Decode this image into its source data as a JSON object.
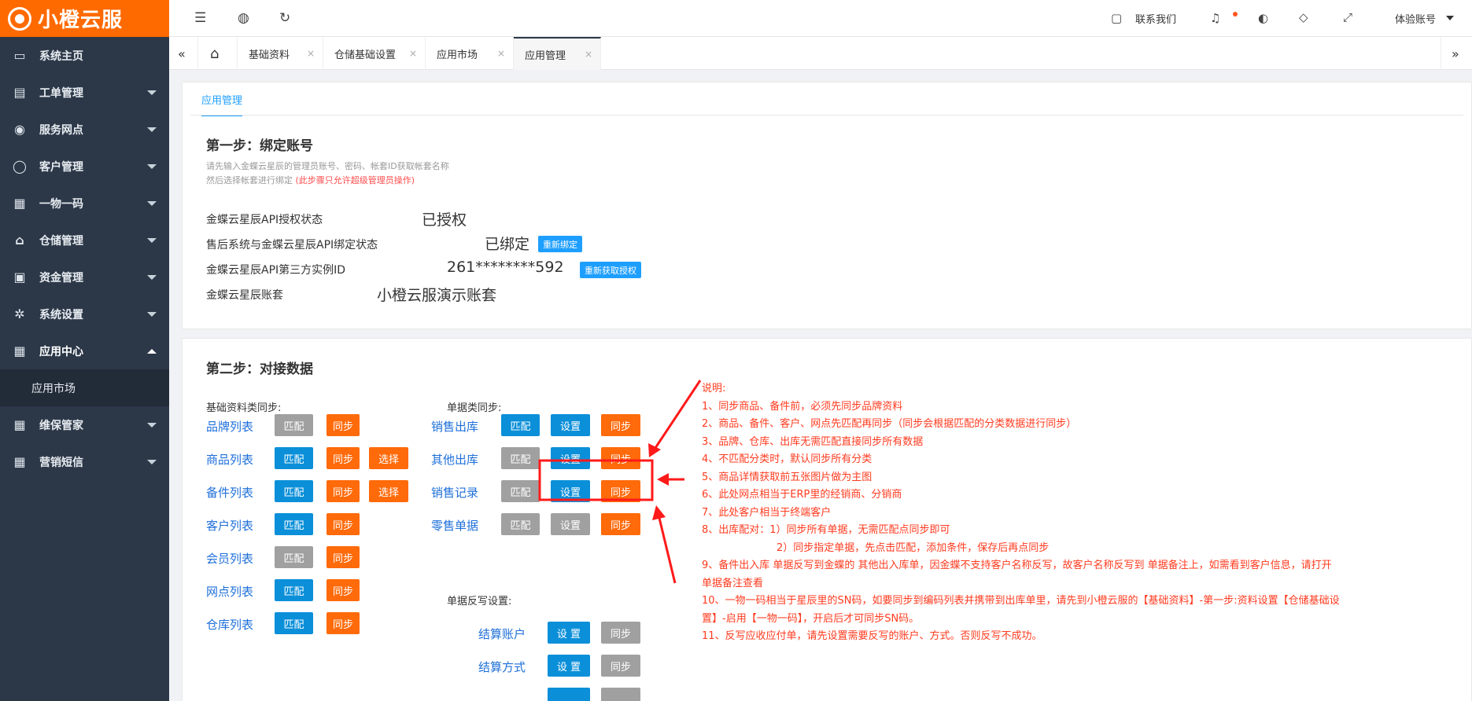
{
  "app": {
    "logo_text": "小橙云服"
  },
  "sidebar": {
    "items": [
      {
        "label": "系统主页",
        "icon": "monitor-icon",
        "caret": false
      },
      {
        "label": "工单管理",
        "icon": "document-icon",
        "caret": true
      },
      {
        "label": "服务网点",
        "icon": "globe-icon",
        "caret": true
      },
      {
        "label": "客户管理",
        "icon": "user-icon",
        "caret": true
      },
      {
        "label": "一物一码",
        "icon": "grid-icon",
        "caret": true
      },
      {
        "label": "仓储管理",
        "icon": "bank-icon",
        "caret": true
      },
      {
        "label": "资金管理",
        "icon": "money-icon",
        "caret": true
      },
      {
        "label": "系统设置",
        "icon": "gear-icon",
        "caret": true
      },
      {
        "label": "应用中心",
        "icon": "grid-icon",
        "caret": true,
        "expanded": true
      },
      {
        "label": "维保管家",
        "icon": "grid-icon",
        "caret": true
      },
      {
        "label": "营销短信",
        "icon": "grid-icon",
        "caret": true
      }
    ],
    "sub_item": "应用市场"
  },
  "header": {
    "contact_label": "联系我们",
    "account_label": "体验账号"
  },
  "tabs": [
    {
      "label": "基础资料"
    },
    {
      "label": "仓储基础设置"
    },
    {
      "label": "应用市场"
    },
    {
      "label": "应用管理",
      "active": true
    }
  ],
  "panel1": {
    "subtab": "应用管理",
    "step_title": "第一步：绑定账号",
    "hint_line1": "请先输入金蝶云星辰的管理员账号、密码、帐套ID获取帐套名称",
    "hint_line2": "然后选择帐套进行绑定",
    "hint_red": "(此步骤只允许超级管理员操作)",
    "rows": [
      {
        "label": "金蝶云星辰API授权状态",
        "value": "已授权"
      },
      {
        "label": "售后系统与金蝶云星辰API绑定状态",
        "value": "已绑定",
        "button": "重新绑定"
      },
      {
        "label": "金蝶云星辰API第三方实例ID",
        "value": "261********592",
        "button": "重新获取授权"
      },
      {
        "label": "金蝶云星辰账套",
        "value": "小橙云服演示账套"
      }
    ]
  },
  "panel2": {
    "step_title": "第二步：对接数据",
    "basic_head": "基础资料类同步:",
    "doc_head": "单据类同步:",
    "writeback_head": "单据反写设置:",
    "basic_rows": [
      {
        "label": "品牌列表",
        "match": "匹配",
        "match_color": "gray",
        "sync": "同步"
      },
      {
        "label": "商品列表",
        "match": "匹配",
        "match_color": "blue",
        "sync": "同步",
        "select": "选择"
      },
      {
        "label": "备件列表",
        "match": "匹配",
        "match_color": "blue",
        "sync": "同步",
        "select": "选择"
      },
      {
        "label": "客户列表",
        "match": "匹配",
        "match_color": "blue",
        "sync": "同步"
      },
      {
        "label": "会员列表",
        "match": "匹配",
        "match_color": "gray",
        "sync": "同步"
      },
      {
        "label": "网点列表",
        "match": "匹配",
        "match_color": "blue",
        "sync": "同步"
      },
      {
        "label": "仓库列表",
        "match": "匹配",
        "match_color": "blue",
        "sync": "同步"
      }
    ],
    "doc_rows": [
      {
        "label": "销售出库",
        "match": "匹配",
        "match_color": "blue",
        "setting": "设置",
        "setting_color": "blue",
        "sync": "同步"
      },
      {
        "label": "其他出库",
        "match": "匹配",
        "match_color": "gray",
        "setting": "设置",
        "setting_color": "blue",
        "sync": "同步"
      },
      {
        "label": "销售记录",
        "match": "匹配",
        "match_color": "gray",
        "setting": "设置",
        "setting_color": "blue",
        "sync": "同步"
      },
      {
        "label": "零售单据",
        "match": "匹配",
        "match_color": "gray",
        "setting": "设置",
        "setting_color": "gray",
        "sync": "同步"
      }
    ],
    "writeback_rows": [
      {
        "label": "结算账户",
        "setting": "设 置",
        "sync": "同步"
      },
      {
        "label": "结算方式",
        "setting": "设 置",
        "sync": "同步"
      }
    ],
    "notes": [
      "说明:",
      "1、同步商品、备件前，必须先同步品牌资料",
      "2、商品、备件、客户、网点先匹配再同步（同步会根据匹配的分类数据进行同步）",
      "3、品牌、仓库、出库无需匹配直接同步所有数据",
      "4、不匹配分类时，默认同步所有分类",
      "5、商品详情获取前五张图片做为主图",
      "6、此处网点相当于ERP里的经销商、分销商",
      "7、此处客户相当于终端客户",
      "8、出库配对：1）同步所有单据，无需匹配点同步即可",
      "2）同步指定单据，先点击匹配，添加条件，保存后再点同步",
      "9、备件出入库 单据反写到金蝶的 其他出入库单，因金蝶不支持客户名称反写，故客户名称反写到 单据备注上，如需看到客户信息，请打开",
      "单据备注查看",
      "10、一物一码相当于星辰里的SN码，如要同步到编码列表并携带到出库单里，请先到小橙云服的【基础资料】-第一步:资料设置【仓储基础设",
      "置】-启用【一物一码】，开启后才可同步SN码。",
      "11、反写应收应付单，请先设置需要反写的账户、方式。否则反写不成功。"
    ]
  },
  "colors": {
    "accent": "#ff6a00",
    "sidebar": "#2c3848",
    "blue_btn": "#0b8fd9",
    "orange_btn": "#ff6a0a",
    "gray_btn": "#a0a0a0",
    "note_red": "#ff3b1f"
  }
}
